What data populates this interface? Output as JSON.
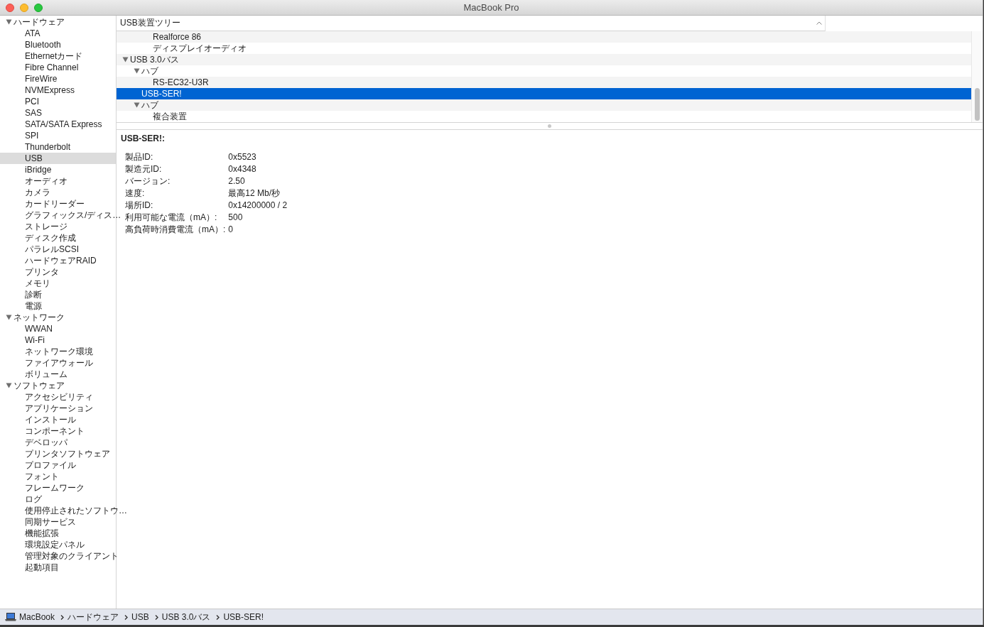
{
  "window": {
    "title": "MacBook Pro"
  },
  "sidebar": {
    "items": [
      {
        "label": "ハードウェア",
        "expanded": true,
        "selected": false,
        "children": [
          {
            "label": "ATA",
            "selected": false
          },
          {
            "label": "Bluetooth",
            "selected": false
          },
          {
            "label": "Ethernetカード",
            "selected": false
          },
          {
            "label": "Fibre Channel",
            "selected": false
          },
          {
            "label": "FireWire",
            "selected": false
          },
          {
            "label": "NVMExpress",
            "selected": false
          },
          {
            "label": "PCI",
            "selected": false
          },
          {
            "label": "SAS",
            "selected": false
          },
          {
            "label": "SATA/SATA Express",
            "selected": false
          },
          {
            "label": "SPI",
            "selected": false
          },
          {
            "label": "Thunderbolt",
            "selected": false
          },
          {
            "label": "USB",
            "selected": true
          },
          {
            "label": "iBridge",
            "selected": false
          },
          {
            "label": "オーディオ",
            "selected": false
          },
          {
            "label": "カメラ",
            "selected": false
          },
          {
            "label": "カードリーダー",
            "selected": false
          },
          {
            "label": "グラフィックス/ディス…",
            "selected": false
          },
          {
            "label": "ストレージ",
            "selected": false
          },
          {
            "label": "ディスク作成",
            "selected": false
          },
          {
            "label": "パラレルSCSI",
            "selected": false
          },
          {
            "label": "ハードウェアRAID",
            "selected": false
          },
          {
            "label": "プリンタ",
            "selected": false
          },
          {
            "label": "メモリ",
            "selected": false
          },
          {
            "label": "診断",
            "selected": false
          },
          {
            "label": "電源",
            "selected": false
          }
        ]
      },
      {
        "label": "ネットワーク",
        "expanded": true,
        "selected": false,
        "children": [
          {
            "label": "WWAN",
            "selected": false
          },
          {
            "label": "Wi-Fi",
            "selected": false
          },
          {
            "label": "ネットワーク環境",
            "selected": false
          },
          {
            "label": "ファイアウォール",
            "selected": false
          },
          {
            "label": "ボリューム",
            "selected": false
          }
        ]
      },
      {
        "label": "ソフトウェア",
        "expanded": true,
        "selected": false,
        "children": [
          {
            "label": "アクセシビリティ",
            "selected": false
          },
          {
            "label": "アプリケーション",
            "selected": false
          },
          {
            "label": "インストール",
            "selected": false
          },
          {
            "label": "コンポーネント",
            "selected": false
          },
          {
            "label": "デベロッパ",
            "selected": false
          },
          {
            "label": "プリンタソフトウェア",
            "selected": false
          },
          {
            "label": "プロファイル",
            "selected": false
          },
          {
            "label": "フォント",
            "selected": false
          },
          {
            "label": "フレームワーク",
            "selected": false
          },
          {
            "label": "ログ",
            "selected": false
          },
          {
            "label": "使用停止されたソフトウ…",
            "selected": false
          },
          {
            "label": "同期サービス",
            "selected": false
          },
          {
            "label": "機能拡張",
            "selected": false
          },
          {
            "label": "環境設定パネル",
            "selected": false
          },
          {
            "label": "管理対象のクライアント",
            "selected": false
          },
          {
            "label": "起動項目",
            "selected": false
          }
        ]
      }
    ]
  },
  "tree": {
    "column": "USB装置ツリー",
    "continued_rows": [
      {
        "label": "Realforce 86",
        "selected": false
      },
      {
        "label": "ディスプレイオーディオ",
        "selected": false
      }
    ],
    "items": [
      {
        "label": "USB 3.0バス",
        "expanded": true,
        "selected": false,
        "children": [
          {
            "label": "ハブ",
            "expanded": true,
            "selected": false,
            "children": [
              {
                "label": "RS-EC32-U3R",
                "selected": false
              }
            ]
          },
          {
            "label": "USB-SER!",
            "selected": true
          },
          {
            "label": "ハブ",
            "expanded": true,
            "selected": false,
            "children": [
              {
                "label": "複合装置",
                "selected": false
              }
            ]
          }
        ]
      }
    ]
  },
  "details": {
    "title": "USB-SER!:",
    "rows": [
      {
        "label": "製品ID:",
        "value": "0x5523"
      },
      {
        "label": "製造元ID:",
        "value": "0x4348"
      },
      {
        "label": "バージョン:",
        "value": "2.50"
      },
      {
        "label": "速度:",
        "value": "最高12 Mb/秒"
      },
      {
        "label": "場所ID:",
        "value": "0x14200000 / 2"
      },
      {
        "label": "利用可能な電流（mA）:",
        "value": "500"
      },
      {
        "label": "高負荷時消費電流（mA）:",
        "value": "0"
      }
    ]
  },
  "status_bar": {
    "path": [
      "MacBook",
      "ハードウェア",
      "USB",
      "USB 3.0バス",
      "USB-SER!"
    ]
  }
}
